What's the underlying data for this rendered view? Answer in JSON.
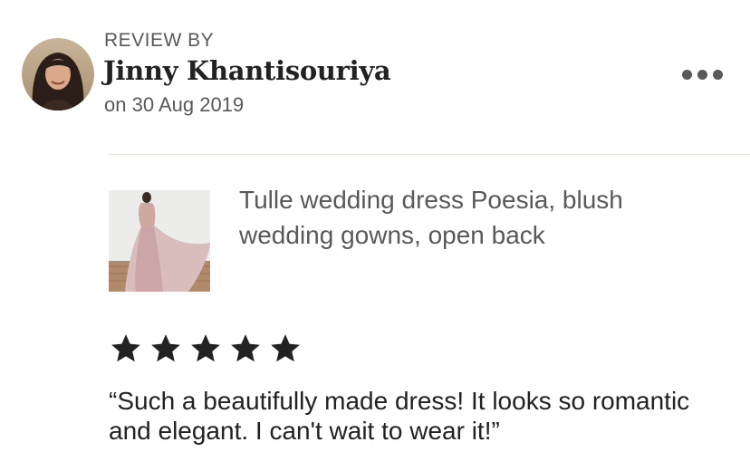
{
  "review": {
    "header_label": "REVIEW BY",
    "reviewer_name": "Jinny Khantisouriya",
    "date": "on 30 Aug 2019",
    "avatar_icon": "reviewer-photo",
    "more_icon": "more-options-icon",
    "rating": 5,
    "rating_max": 5,
    "text": "“Such a beautifully made dress! It looks so romantic and elegant. I can't wait to wear it!”"
  },
  "product": {
    "title": "Tulle wedding dress Poesia, blush wedding gowns, open back",
    "thumbnail_icon": "product-photo"
  },
  "colors": {
    "text_primary": "#222222",
    "text_secondary": "#595959",
    "divider": "#e1e3df",
    "star": "#222222"
  }
}
